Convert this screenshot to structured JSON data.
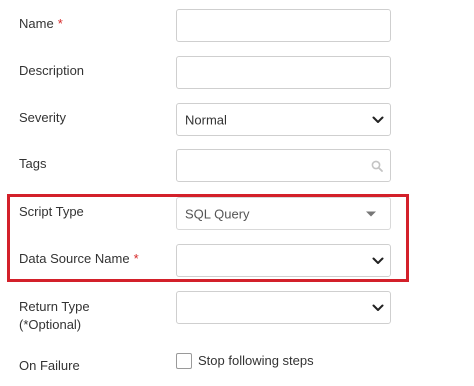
{
  "form": {
    "name": {
      "label": "Name",
      "required_mark": "*",
      "value": ""
    },
    "description": {
      "label": "Description",
      "value": ""
    },
    "severity": {
      "label": "Severity",
      "value": "Normal"
    },
    "tags": {
      "label": "Tags",
      "value": ""
    },
    "script_type": {
      "label": "Script Type",
      "value": "SQL Query"
    },
    "data_source_name": {
      "label": "Data Source Name",
      "required_mark": "*",
      "value": ""
    },
    "return_type": {
      "label_line1": "Return Type",
      "label_line2": "(*Optional)",
      "value": ""
    },
    "on_failure": {
      "label": "On Failure",
      "checkbox_label": "Stop following steps",
      "checked": false
    }
  },
  "colors": {
    "required": "#d62727",
    "highlight_border": "#d3202a",
    "field_border": "#cfcfcf",
    "text": "#333333"
  },
  "icons": {
    "dropdown": "chevron-down-icon",
    "readonly_dropdown": "caret-down-icon",
    "tags_search": "search-icon"
  }
}
